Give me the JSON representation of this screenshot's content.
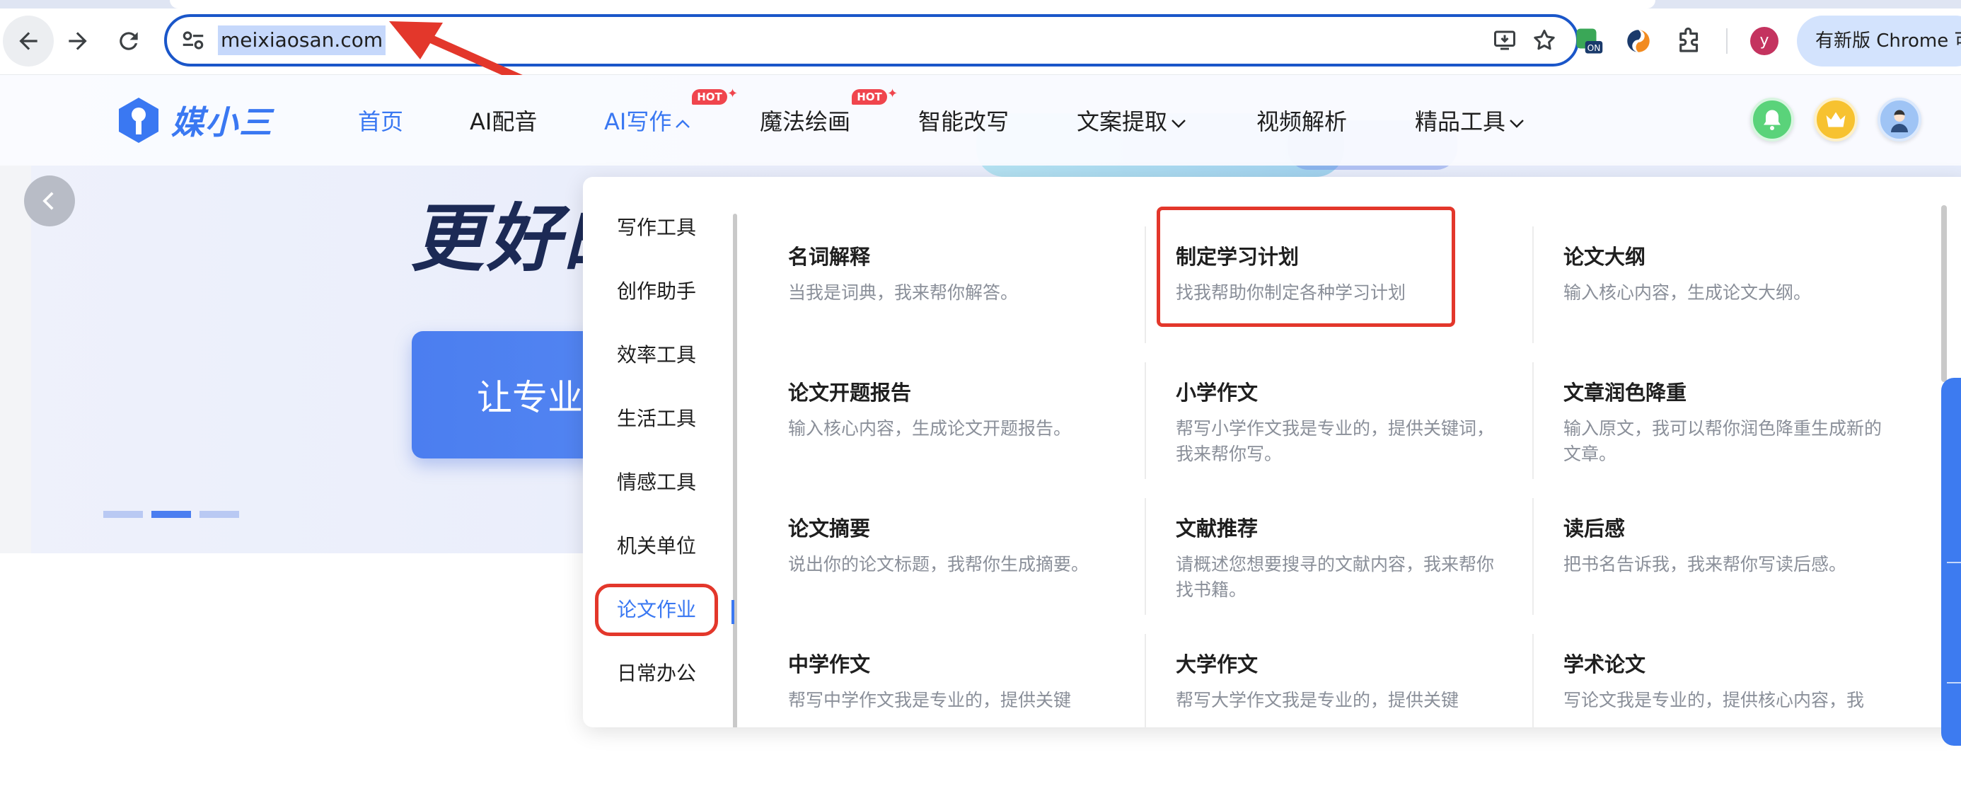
{
  "browser": {
    "url": "meixiaosan.com",
    "update_label": "有新版 Chrome 可",
    "profile_initial": "y",
    "ext_badge": "ON"
  },
  "site": {
    "logo_text": "媒小三",
    "nav": [
      {
        "label": "首页",
        "active": true
      },
      {
        "label": "AI配音"
      },
      {
        "label": "AI写作",
        "caret": "up",
        "hot": true
      },
      {
        "label": "魔法绘画",
        "hot": true
      },
      {
        "label": "智能改写"
      },
      {
        "label": "文案提取",
        "caret": "down"
      },
      {
        "label": "视频解析"
      },
      {
        "label": "精品工具",
        "caret": "down"
      }
    ],
    "hot_badge": "HOT"
  },
  "hero": {
    "title": "更好的",
    "cta": "让专业更"
  },
  "dropdown": {
    "categories": [
      "写作工具",
      "创作助手",
      "效率工具",
      "生活工具",
      "情感工具",
      "机关单位",
      "论文作业",
      "日常办公"
    ],
    "active_category": "论文作业",
    "items": [
      {
        "title": "名词解释",
        "desc": "当我是词典，我来帮你解答。"
      },
      {
        "title": "制定学习计划",
        "desc": "找我帮助你制定各种学习计划"
      },
      {
        "title": "论文大纲",
        "desc": "输入核心内容，生成论文大纲。"
      },
      {
        "title": "论文开题报告",
        "desc": "输入核心内容，生成论文开题报告。"
      },
      {
        "title": "小学作文",
        "desc": "帮写小学作文我是专业的，提供关键词，我来帮你写。"
      },
      {
        "title": "文章润色降重",
        "desc": "输入原文，我可以帮你润色降重生成新的文章。"
      },
      {
        "title": "论文摘要",
        "desc": "说出你的论文标题，我帮你生成摘要。"
      },
      {
        "title": "文献推荐",
        "desc": "请概述您想要搜寻的文献内容，我来帮你找书籍。"
      },
      {
        "title": "读后感",
        "desc": "把书名告诉我，我来帮你写读后感。"
      },
      {
        "title": "中学作文",
        "desc": "帮写中学作文我是专业的，提供关键"
      },
      {
        "title": "大学作文",
        "desc": "帮写大学作文我是专业的，提供关键"
      },
      {
        "title": "学术论文",
        "desc": "写论文我是专业的，提供核心内容，我"
      }
    ]
  },
  "colors": {
    "accent": "#3a78f2",
    "annotation_red": "#e3372b"
  }
}
